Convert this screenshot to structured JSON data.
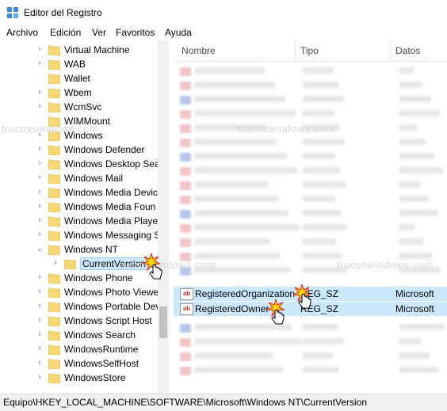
{
  "window": {
    "title": "Editor del Registro"
  },
  "menu": [
    "Archivo",
    "Edición",
    "Ver",
    "Favoritos",
    "Ayuda"
  ],
  "tree": {
    "items": [
      {
        "label": "Virtual Machine",
        "expander": "›"
      },
      {
        "label": "WAB",
        "expander": "›"
      },
      {
        "label": "Wallet",
        "expander": ""
      },
      {
        "label": "Wbem",
        "expander": "›"
      },
      {
        "label": "WcmSvc",
        "expander": "›"
      },
      {
        "label": "WIMMount",
        "expander": ""
      },
      {
        "label": "Windows",
        "expander": "›"
      },
      {
        "label": "Windows Defender",
        "expander": "›"
      },
      {
        "label": "Windows Desktop Sea",
        "expander": "›"
      },
      {
        "label": "Windows Mail",
        "expander": "›"
      },
      {
        "label": "Windows Media Devic",
        "expander": "›"
      },
      {
        "label": "Windows Media Foun",
        "expander": "›"
      },
      {
        "label": "Windows Media Playe",
        "expander": "›"
      },
      {
        "label": "Windows Messaging S",
        "expander": "›"
      },
      {
        "label": "Windows NT",
        "expander": "⌄"
      },
      {
        "label": "CurrentVersion",
        "expander": "›"
      },
      {
        "label": "Windows Phone",
        "expander": "›"
      },
      {
        "label": "Windows Photo Viewe",
        "expander": "›"
      },
      {
        "label": "Windows Portable Dev",
        "expander": "›"
      },
      {
        "label": "Windows Script Host",
        "expander": "›"
      },
      {
        "label": "Windows Search",
        "expander": "›"
      },
      {
        "label": "WindowsRuntime",
        "expander": "›"
      },
      {
        "label": "WindowsSelfHost",
        "expander": "›"
      },
      {
        "label": "WindowsStore",
        "expander": "›"
      }
    ]
  },
  "list": {
    "columns": [
      "Nombre",
      "Tipo",
      "Datos"
    ],
    "rows": [
      {
        "name": "RegisteredOrganization",
        "type": "REG_SZ",
        "data": "Microsoft"
      },
      {
        "name": "RegisteredOwner",
        "type": "REG_SZ",
        "data": "Microsoft"
      }
    ]
  },
  "watermarks": [
    "trucoswindows.com",
    "trucoswindows.com",
    "trucoswindows.com",
    "trucoswindows.com"
  ],
  "status": {
    "path": "Equipo\\HKEY_LOCAL_MACHINE\\SOFTWARE\\Microsoft\\Windows NT\\CurrentVersion"
  },
  "icons": {
    "folder": "folder-icon",
    "string_value": "string-value-icon",
    "cursor": "hand-cursor-icon"
  },
  "colors": {
    "selection": "#cce8ff",
    "folder": "#f8d775",
    "ab_text": "#c0392b"
  }
}
